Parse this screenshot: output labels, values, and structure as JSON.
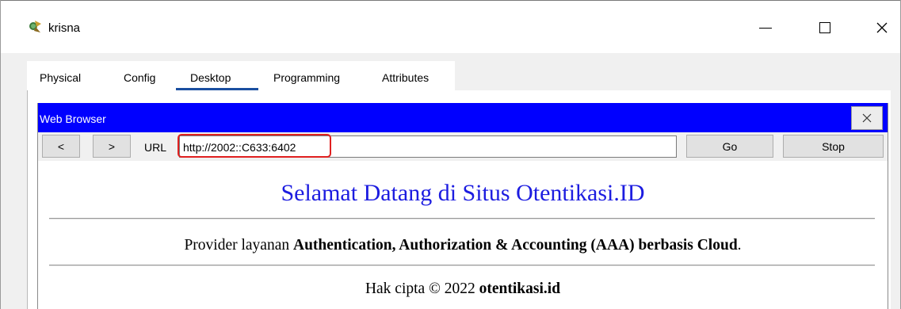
{
  "window": {
    "title": "krisna",
    "icon": "packet-tracer-device-icon",
    "controls": {
      "minimize": "—",
      "maximize": "☐",
      "close": "✕"
    }
  },
  "tabs": [
    {
      "label": "Physical"
    },
    {
      "label": "Config"
    },
    {
      "label": "Desktop",
      "active": true
    },
    {
      "label": "Programming"
    },
    {
      "label": "Attributes"
    }
  ],
  "browser": {
    "title": "Web Browser",
    "close_label": "X",
    "back_label": "<",
    "forward_label": ">",
    "url_label": "URL",
    "url_value": "http://2002::C633:6402",
    "go_label": "Go",
    "stop_label": "Stop",
    "title_bar_color": "#0000ff"
  },
  "page": {
    "heading": "Selamat Datang di Situs Otentikasi.ID",
    "heading_color": "#1c1ce0",
    "provider_prefix": "Provider layanan ",
    "provider_bold": "Authentication, Authorization & Accounting (AAA) berbasis Cloud",
    "provider_suffix": ".",
    "copyright_prefix": "Hak cipta © 2022 ",
    "copyright_bold": "otentikasi.id"
  }
}
